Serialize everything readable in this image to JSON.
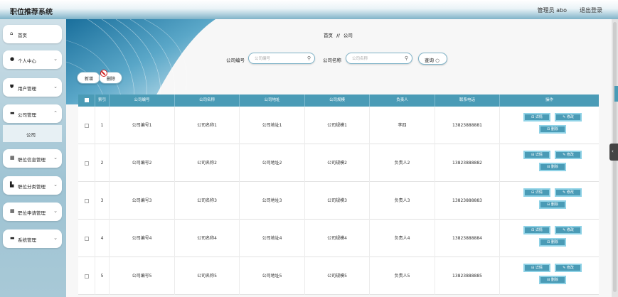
{
  "header": {
    "title": "职位推荐系统",
    "user": "管理员 abo",
    "logout": "退出登录"
  },
  "sidebar": {
    "items": [
      {
        "label": "首页",
        "icon": "home-icon",
        "glyph": "⌂",
        "chevron": false
      },
      {
        "label": "个人中心",
        "icon": "user-icon",
        "glyph": "●",
        "chevron": true
      },
      {
        "label": "用户管理",
        "icon": "shield-icon",
        "glyph": "⛊",
        "chevron": true
      },
      {
        "label": "公司管理",
        "icon": "monitor-icon",
        "glyph": "▬",
        "chevron": true
      },
      {
        "label": "职位信息管理",
        "icon": "grid-icon",
        "glyph": "▦",
        "chevron": true
      },
      {
        "label": "职位分类管理",
        "icon": "chart-icon",
        "glyph": "▙",
        "chevron": true
      },
      {
        "label": "职位申请管理",
        "icon": "grid-icon",
        "glyph": "▦",
        "chevron": true
      },
      {
        "label": "系统管理",
        "icon": "monitor-icon",
        "glyph": "▬",
        "chevron": true
      }
    ],
    "submenu": {
      "label": "公司"
    }
  },
  "breadcrumb": {
    "home": "首页",
    "separator": "//",
    "current": "公司"
  },
  "search": {
    "code_label": "公司编号",
    "code_placeholder": "公司编号",
    "name_label": "公司名称",
    "name_placeholder": "公司名称",
    "query_label": "查询 ○"
  },
  "actions": {
    "add": "新增",
    "delete": "删除"
  },
  "table": {
    "headers": [
      "",
      "索引",
      "公司编号",
      "公司名称",
      "公司地址",
      "公司规模",
      "负责人",
      "联系电话",
      "操作"
    ],
    "rows": [
      {
        "index": "1",
        "code": "公司编号1",
        "name": "公司名称1",
        "address": "公司地址1",
        "scale": "公司规模1",
        "manager": "李四",
        "phone": "13823888881"
      },
      {
        "index": "2",
        "code": "公司编号2",
        "name": "公司名称2",
        "address": "公司地址2",
        "scale": "公司规模2",
        "manager": "负责人2",
        "phone": "13823888882"
      },
      {
        "index": "3",
        "code": "公司编号3",
        "name": "公司名称3",
        "address": "公司地址3",
        "scale": "公司规模3",
        "manager": "负责人3",
        "phone": "13823888883"
      },
      {
        "index": "4",
        "code": "公司编号4",
        "name": "公司名称4",
        "address": "公司地址4",
        "scale": "公司规模4",
        "manager": "负责人4",
        "phone": "13823888884"
      },
      {
        "index": "5",
        "code": "公司编号5",
        "name": "公司名称5",
        "address": "公司地址5",
        "scale": "公司规模5",
        "manager": "负责人5",
        "phone": "13823888885"
      }
    ],
    "op_labels": {
      "detail": "⊟ 详情",
      "edit": "✎ 修改",
      "delete": "⊟ 删除"
    }
  },
  "colors": {
    "accent": "#4a9bb6",
    "header_gradient_end": "#7fb3c8",
    "sidebar_bg": "#a8c9d7",
    "danger": "#d31f1f"
  }
}
